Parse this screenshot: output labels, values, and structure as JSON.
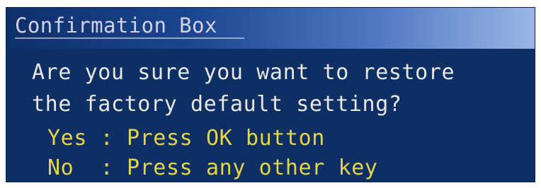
{
  "dialog": {
    "title": "Confirmation Box",
    "message_line1": "Are you sure you want to restore",
    "message_line2": "the factory default setting?",
    "options": [
      {
        "key": "Yes ",
        "separator": ": ",
        "action": "Press OK button"
      },
      {
        "key": "No  ",
        "separator": ": ",
        "action": "Press any other key"
      }
    ]
  },
  "colors": {
    "background": "#0e2f63",
    "title_gradient_start": "#0d2f6a",
    "title_gradient_end": "#9bb6e6",
    "message_text": "#e8e6e0",
    "option_text": "#e6d44a"
  }
}
